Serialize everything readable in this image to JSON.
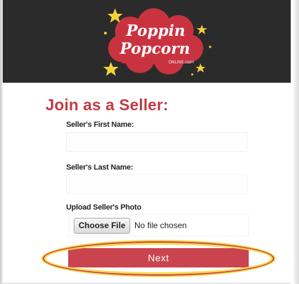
{
  "header": {
    "logo": {
      "word1": "Poppin",
      "word2": "Popcorn",
      "tagline": "ONLINE.com",
      "icon": "popcorn-cloud-logo"
    }
  },
  "form": {
    "title": "Join as a Seller:",
    "first_name_label": "Seller's First Name:",
    "first_name_value": "",
    "last_name_label": "Seller's Last Name:",
    "last_name_value": "",
    "photo_label": "Upload Seller's Photo",
    "choose_file_label": "Choose File",
    "file_status": "No file chosen",
    "next_label": "Next"
  },
  "colors": {
    "header_bg": "#2b2b2b",
    "brand_red": "#c23b45",
    "button_red": "#c9444e",
    "highlight_yellow": "#f5d73c",
    "star_yellow": "#f4d23a"
  }
}
